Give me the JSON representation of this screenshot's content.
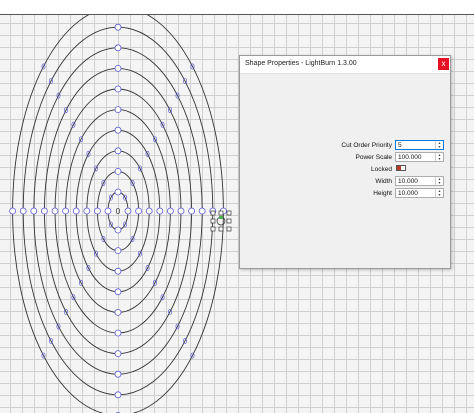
{
  "dialog": {
    "title": "Shape Properties - LightBurn 1.3.00",
    "close_glyph": "x",
    "fields": {
      "cut_order_priority": {
        "label": "Cut Order Priority",
        "value": "5"
      },
      "power_scale": {
        "label": "Power Scale",
        "value": "100.000"
      },
      "locked": {
        "label": "Locked",
        "on": false
      },
      "width": {
        "label": "Width",
        "value": "10.000"
      },
      "height": {
        "label": "Height",
        "value": "10.000"
      }
    }
  },
  "canvas": {
    "rings": 10,
    "center_label": "0",
    "colors": {
      "ring": "#333333",
      "marker": "#5b5bd6",
      "accent": "#e81123"
    }
  }
}
